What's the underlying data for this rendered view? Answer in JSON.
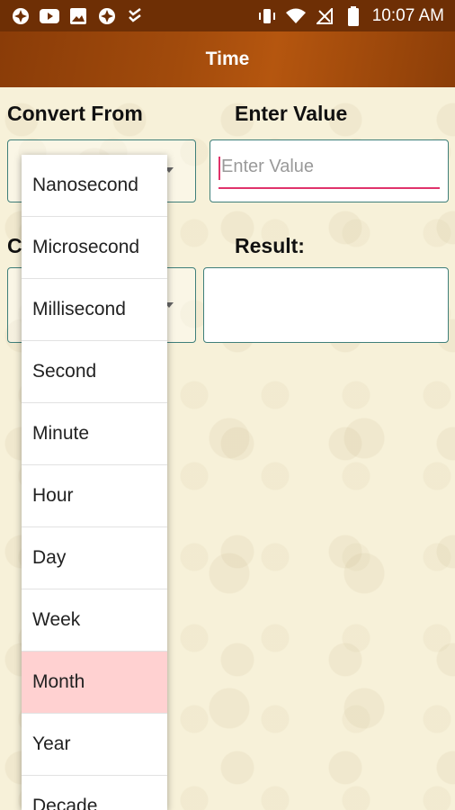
{
  "status_bar": {
    "time": "10:07 AM",
    "icons": [
      "app-icon",
      "youtube-icon",
      "image-icon",
      "app-icon",
      "checklist-icon",
      "vibrate-icon",
      "wifi-icon",
      "no-signal-icon",
      "battery-icon"
    ]
  },
  "toolbar": {
    "title": "Time"
  },
  "form": {
    "convert_from_label": "Convert From",
    "enter_value_label": "Enter Value",
    "input_placeholder": "Enter Value",
    "convert_to_label_partial": "C",
    "result_label": "Result:"
  },
  "dropdown": {
    "items": [
      "Nanosecond",
      "Microsecond",
      "Millisecond",
      "Second",
      "Minute",
      "Hour",
      "Day",
      "Week",
      "Month",
      "Year",
      "Decade"
    ],
    "highlighted": "Month"
  },
  "colors": {
    "statusbar": "#6e2f05",
    "toolbar": "#a24b0c",
    "accent": "#e0336b",
    "border": "#3f7f7a",
    "highlight": "#ffd1d1"
  }
}
